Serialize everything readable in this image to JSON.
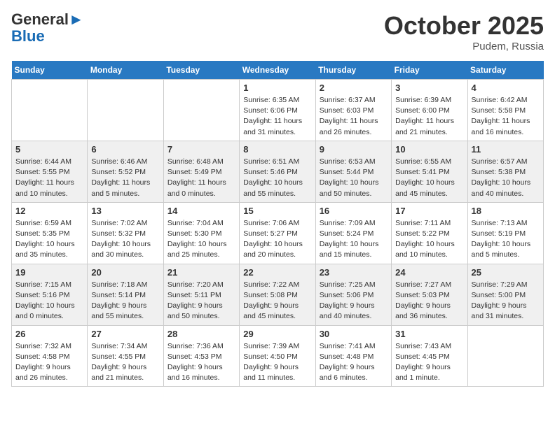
{
  "logo": {
    "general": "General",
    "blue": "Blue"
  },
  "title": "October 2025",
  "location": "Pudem, Russia",
  "days_of_week": [
    "Sunday",
    "Monday",
    "Tuesday",
    "Wednesday",
    "Thursday",
    "Friday",
    "Saturday"
  ],
  "weeks": [
    [
      {
        "day": "",
        "info": ""
      },
      {
        "day": "",
        "info": ""
      },
      {
        "day": "",
        "info": ""
      },
      {
        "day": "1",
        "info": "Sunrise: 6:35 AM\nSunset: 6:06 PM\nDaylight: 11 hours\nand 31 minutes."
      },
      {
        "day": "2",
        "info": "Sunrise: 6:37 AM\nSunset: 6:03 PM\nDaylight: 11 hours\nand 26 minutes."
      },
      {
        "day": "3",
        "info": "Sunrise: 6:39 AM\nSunset: 6:00 PM\nDaylight: 11 hours\nand 21 minutes."
      },
      {
        "day": "4",
        "info": "Sunrise: 6:42 AM\nSunset: 5:58 PM\nDaylight: 11 hours\nand 16 minutes."
      }
    ],
    [
      {
        "day": "5",
        "info": "Sunrise: 6:44 AM\nSunset: 5:55 PM\nDaylight: 11 hours\nand 10 minutes."
      },
      {
        "day": "6",
        "info": "Sunrise: 6:46 AM\nSunset: 5:52 PM\nDaylight: 11 hours\nand 5 minutes."
      },
      {
        "day": "7",
        "info": "Sunrise: 6:48 AM\nSunset: 5:49 PM\nDaylight: 11 hours\nand 0 minutes."
      },
      {
        "day": "8",
        "info": "Sunrise: 6:51 AM\nSunset: 5:46 PM\nDaylight: 10 hours\nand 55 minutes."
      },
      {
        "day": "9",
        "info": "Sunrise: 6:53 AM\nSunset: 5:44 PM\nDaylight: 10 hours\nand 50 minutes."
      },
      {
        "day": "10",
        "info": "Sunrise: 6:55 AM\nSunset: 5:41 PM\nDaylight: 10 hours\nand 45 minutes."
      },
      {
        "day": "11",
        "info": "Sunrise: 6:57 AM\nSunset: 5:38 PM\nDaylight: 10 hours\nand 40 minutes."
      }
    ],
    [
      {
        "day": "12",
        "info": "Sunrise: 6:59 AM\nSunset: 5:35 PM\nDaylight: 10 hours\nand 35 minutes."
      },
      {
        "day": "13",
        "info": "Sunrise: 7:02 AM\nSunset: 5:32 PM\nDaylight: 10 hours\nand 30 minutes."
      },
      {
        "day": "14",
        "info": "Sunrise: 7:04 AM\nSunset: 5:30 PM\nDaylight: 10 hours\nand 25 minutes."
      },
      {
        "day": "15",
        "info": "Sunrise: 7:06 AM\nSunset: 5:27 PM\nDaylight: 10 hours\nand 20 minutes."
      },
      {
        "day": "16",
        "info": "Sunrise: 7:09 AM\nSunset: 5:24 PM\nDaylight: 10 hours\nand 15 minutes."
      },
      {
        "day": "17",
        "info": "Sunrise: 7:11 AM\nSunset: 5:22 PM\nDaylight: 10 hours\nand 10 minutes."
      },
      {
        "day": "18",
        "info": "Sunrise: 7:13 AM\nSunset: 5:19 PM\nDaylight: 10 hours\nand 5 minutes."
      }
    ],
    [
      {
        "day": "19",
        "info": "Sunrise: 7:15 AM\nSunset: 5:16 PM\nDaylight: 10 hours\nand 0 minutes."
      },
      {
        "day": "20",
        "info": "Sunrise: 7:18 AM\nSunset: 5:14 PM\nDaylight: 9 hours\nand 55 minutes."
      },
      {
        "day": "21",
        "info": "Sunrise: 7:20 AM\nSunset: 5:11 PM\nDaylight: 9 hours\nand 50 minutes."
      },
      {
        "day": "22",
        "info": "Sunrise: 7:22 AM\nSunset: 5:08 PM\nDaylight: 9 hours\nand 45 minutes."
      },
      {
        "day": "23",
        "info": "Sunrise: 7:25 AM\nSunset: 5:06 PM\nDaylight: 9 hours\nand 40 minutes."
      },
      {
        "day": "24",
        "info": "Sunrise: 7:27 AM\nSunset: 5:03 PM\nDaylight: 9 hours\nand 36 minutes."
      },
      {
        "day": "25",
        "info": "Sunrise: 7:29 AM\nSunset: 5:00 PM\nDaylight: 9 hours\nand 31 minutes."
      }
    ],
    [
      {
        "day": "26",
        "info": "Sunrise: 7:32 AM\nSunset: 4:58 PM\nDaylight: 9 hours\nand 26 minutes."
      },
      {
        "day": "27",
        "info": "Sunrise: 7:34 AM\nSunset: 4:55 PM\nDaylight: 9 hours\nand 21 minutes."
      },
      {
        "day": "28",
        "info": "Sunrise: 7:36 AM\nSunset: 4:53 PM\nDaylight: 9 hours\nand 16 minutes."
      },
      {
        "day": "29",
        "info": "Sunrise: 7:39 AM\nSunset: 4:50 PM\nDaylight: 9 hours\nand 11 minutes."
      },
      {
        "day": "30",
        "info": "Sunrise: 7:41 AM\nSunset: 4:48 PM\nDaylight: 9 hours\nand 6 minutes."
      },
      {
        "day": "31",
        "info": "Sunrise: 7:43 AM\nSunset: 4:45 PM\nDaylight: 9 hours\nand 1 minute."
      },
      {
        "day": "",
        "info": ""
      }
    ]
  ]
}
